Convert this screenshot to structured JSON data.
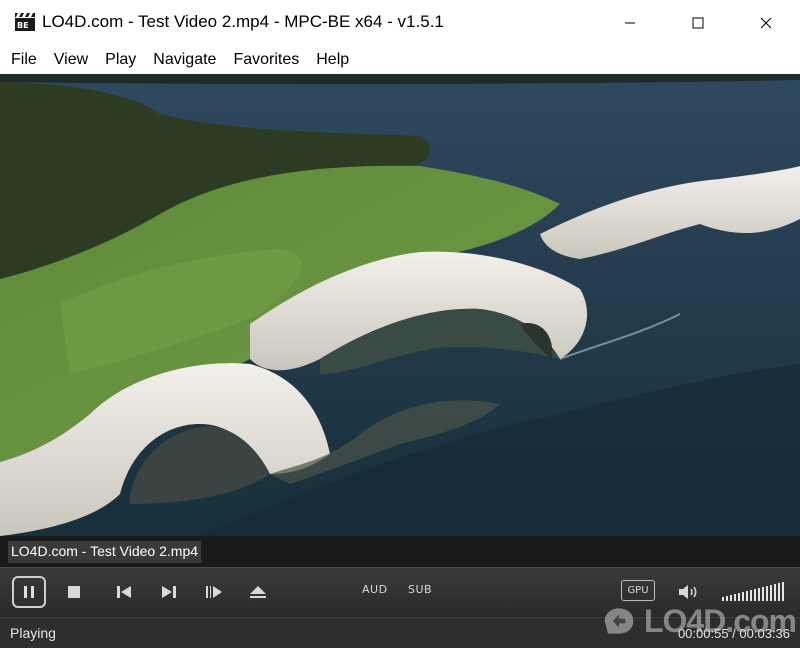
{
  "window": {
    "title": "LO4D.com - Test Video 2.mp4 - MPC-BE x64 - v1.5.1",
    "app_icon": "mpc-be-clapper-icon",
    "controls": [
      "minimize-icon",
      "maximize-icon",
      "close-icon"
    ]
  },
  "menu": {
    "items": [
      {
        "label": "File"
      },
      {
        "label": "View"
      },
      {
        "label": "Play"
      },
      {
        "label": "Navigate"
      },
      {
        "label": "Favorites"
      },
      {
        "label": "Help"
      }
    ]
  },
  "video": {
    "content": "aerial-coastline-chalk-cliffs"
  },
  "filename_bar": {
    "label": "LO4D.com - Test Video 2.mp4"
  },
  "controls": {
    "aud_label": "AUD",
    "sub_label": "SUB",
    "gpu_label": "GPU",
    "volume_level": 1.0,
    "icons": [
      "pause-icon",
      "stop-icon",
      "previous-icon",
      "next-icon",
      "frame-step-icon",
      "eject-icon",
      "speaker-icon"
    ]
  },
  "status": {
    "state": "Playing",
    "time": "00:00:55 / 00:03:36"
  },
  "watermark": {
    "text": "LO4D.com"
  },
  "colors": {
    "control_bg": "#2e2e2e",
    "control_fg": "#d8d8d8"
  }
}
